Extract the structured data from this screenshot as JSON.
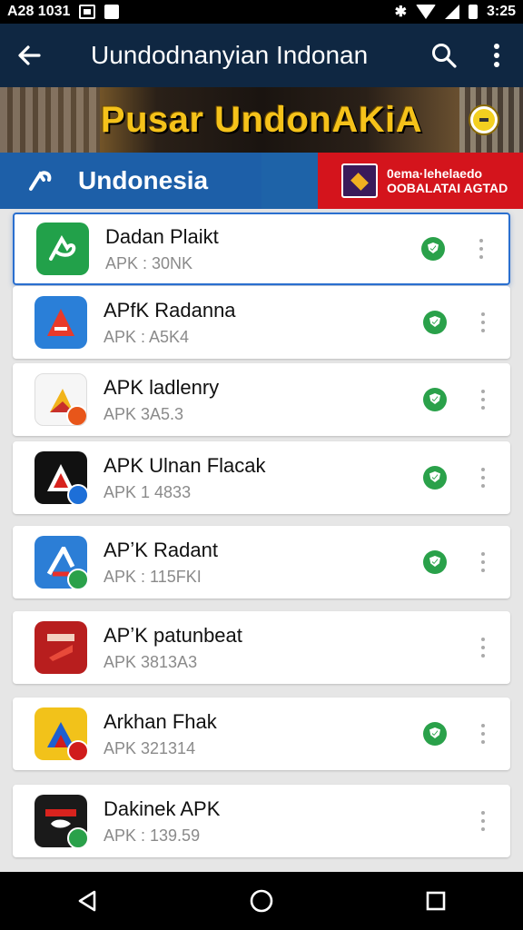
{
  "status_bar": {
    "left_text": "A28 1031",
    "time": "3:25"
  },
  "toolbar": {
    "title": "Uundodnanyian Indonan"
  },
  "banner": {
    "text": "Pusar UndonAKiA"
  },
  "region": {
    "label": "Undonesia",
    "promo_line1": "0ema·lehelaedo",
    "promo_line2": "OOBALATAI AGTAD"
  },
  "apps": [
    {
      "name": "Dadan Plaikt",
      "size": "APK : 30NK",
      "verified": true,
      "icon_bg": "#22a14a",
      "badge": "",
      "selected": true
    },
    {
      "name": "APfK Radanna",
      "size": "APK : A5K4",
      "verified": true,
      "icon_bg": "#2a7fd8",
      "badge": "",
      "selected": false
    },
    {
      "name": "APK ladlenry",
      "size": "APK 3A5.3",
      "verified": true,
      "icon_bg": "#f6f6f6",
      "badge": "#e8561a",
      "selected": false
    },
    {
      "name": "APK Ulnan Flacak",
      "size": "APK 1 4833",
      "verified": true,
      "icon_bg": "#111111",
      "badge": "#1d6fd8",
      "selected": false
    },
    {
      "name": "APʼK Radant",
      "size": "APK : 115FKI",
      "verified": true,
      "icon_bg": "#2c7ed6",
      "badge": "#2aa14a",
      "selected": false
    },
    {
      "name": "APʼK patunbeat",
      "size": "APK 3813A3",
      "verified": false,
      "icon_bg": "#b81e1e",
      "badge": "",
      "selected": false
    },
    {
      "name": "Arkhan Fhak",
      "size": "APK 321314",
      "verified": true,
      "icon_bg": "#f2c21a",
      "badge": "#d01c1c",
      "selected": false
    },
    {
      "name": "Dakinek APK",
      "size": "APK : 139.59",
      "verified": false,
      "icon_bg": "#1a1a1a",
      "badge": "#2aa14a",
      "selected": false
    }
  ],
  "colors": {
    "toolbar": "#0f2742",
    "region_blue": "#1d5fa8",
    "region_red": "#d4141c",
    "verified_green": "#2aa14a"
  },
  "icons": {
    "back": "arrow-left-icon",
    "search": "search-icon",
    "more": "more-vertical-icon",
    "nav_back": "triangle-back-icon",
    "nav_home": "circle-home-icon",
    "nav_recent": "square-recent-icon"
  }
}
